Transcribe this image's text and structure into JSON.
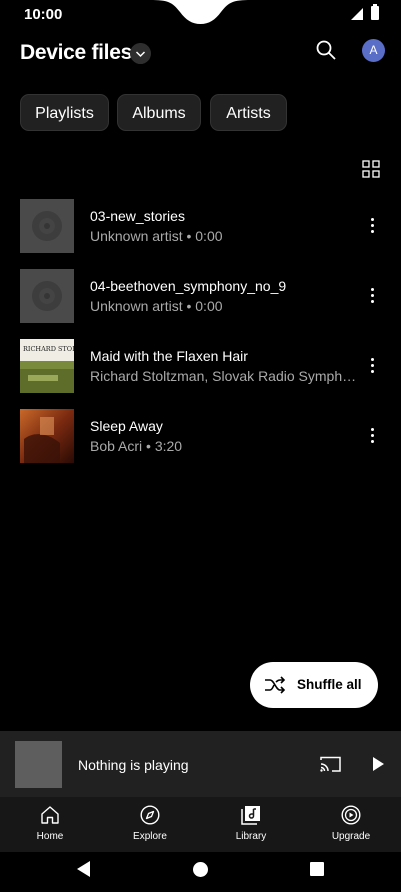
{
  "status_bar": {
    "time": "10:00"
  },
  "header": {
    "title": "Device files",
    "avatar_letter": "A"
  },
  "chips": [
    "Playlists",
    "Albums",
    "Artists"
  ],
  "songs": [
    {
      "title": "03-new_stories",
      "subtitle": "Unknown artist • 0:00",
      "art": "placeholder-disc"
    },
    {
      "title": "04-beethoven_symphony_no_9",
      "subtitle": "Unknown artist • 0:00",
      "art": "placeholder-disc"
    },
    {
      "title": "Maid with the Flaxen Hair",
      "subtitle": "Richard Stoltzman, Slovak Radio Symph…",
      "art": "album-cover",
      "art_text": "RICHARD STOLTZMAN"
    },
    {
      "title": "Sleep Away",
      "subtitle": "Bob Acri • 3:20",
      "art": "album-cover-warm"
    }
  ],
  "shuffle": {
    "label": "Shuffle all"
  },
  "mini_player": {
    "text": "Nothing is playing"
  },
  "nav": [
    {
      "label": "Home",
      "icon": "home-icon"
    },
    {
      "label": "Explore",
      "icon": "compass-icon"
    },
    {
      "label": "Library",
      "icon": "library-icon"
    },
    {
      "label": "Upgrade",
      "icon": "upgrade-icon"
    }
  ],
  "colors": {
    "background": "#000000",
    "avatar": "#5b6ec7",
    "chip": "#212121",
    "mini_player": "#212121"
  }
}
